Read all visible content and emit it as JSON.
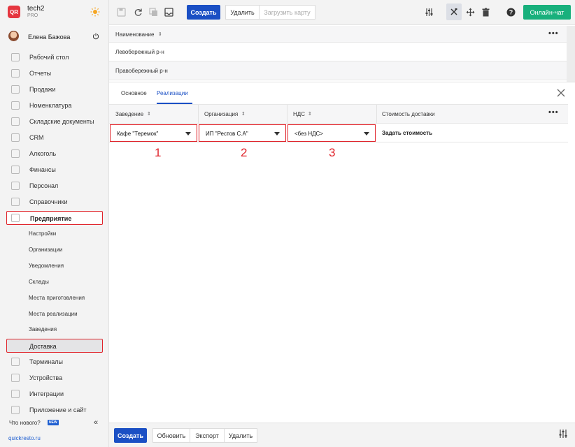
{
  "brand": {
    "logo": "QR",
    "name": "tech2",
    "plan": "PRO"
  },
  "user": {
    "name": "Елена Бажова"
  },
  "sidebar": {
    "items": [
      {
        "label": "Рабочий стол",
        "icon": "speedometer-icon"
      },
      {
        "label": "Отчеты",
        "icon": "chart-icon"
      },
      {
        "label": "Продажи",
        "icon": "basket-icon"
      },
      {
        "label": "Номенклатура",
        "icon": "tag-icon"
      },
      {
        "label": "Складские документы",
        "icon": "warehouse-icon"
      },
      {
        "label": "CRM",
        "icon": "people-icon"
      },
      {
        "label": "Алкоголь",
        "icon": "cocktail-icon"
      },
      {
        "label": "Финансы",
        "icon": "wallet-icon"
      },
      {
        "label": "Персонал",
        "icon": "staff-icon"
      },
      {
        "label": "Справочники",
        "icon": "book-icon"
      },
      {
        "label": "Предприятие",
        "icon": "building-icon"
      }
    ],
    "sub_items": [
      "Настройки",
      "Организации",
      "Уведомления",
      "Склады",
      "Места приготовления",
      "Места реализации",
      "Заведения",
      "Доставка"
    ],
    "items_after": [
      {
        "label": "Терминалы",
        "icon": "terminal-icon"
      },
      {
        "label": "Устройства",
        "icon": "printer-icon"
      },
      {
        "label": "Интеграции",
        "icon": "link-icon"
      },
      {
        "label": "Приложение и сайт",
        "icon": "monitor-icon"
      }
    ],
    "whats_new": "Что нового?",
    "new_badge": "NEW",
    "site": "quickresto.ru"
  },
  "toolbar": {
    "create": "Создать",
    "delete": "Удалить",
    "load_map": "Загрузить карту",
    "chat": "Онлайн-чат"
  },
  "list": {
    "header": "Наименование",
    "rows": [
      "Левобережный р-н",
      "Правобережный р-н"
    ]
  },
  "detail": {
    "tabs": [
      "Основное",
      "Реализации"
    ],
    "columns": [
      "Заведение",
      "Организация",
      "НДС",
      "Стоимость доставки"
    ],
    "row": {
      "venue": "Кафе \"Теремок\"",
      "organization": "ИП \"Рестов С.А\"",
      "vat": "<без НДС>",
      "cost": "Задать стоимость"
    },
    "markers": [
      "1",
      "2",
      "3"
    ]
  },
  "bottom": {
    "create": "Создать",
    "refresh": "Обновить",
    "export": "Экспорт",
    "delete": "Удалить"
  },
  "colors": {
    "primary": "#1a4fc4",
    "green": "#18b07c",
    "highlight": "#e0242b",
    "logo": "#e5363f"
  }
}
